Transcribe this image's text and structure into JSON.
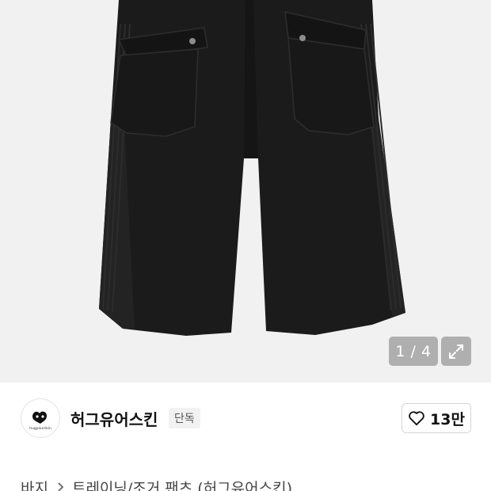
{
  "gallery": {
    "current_page": 1,
    "total_pages": 4,
    "pager_text": "1 / 4",
    "icons": {
      "expand": "expand-arrows-icon"
    }
  },
  "brand": {
    "logo_text": "hugyourskin",
    "name": "허그유어스킨",
    "badge": "단독",
    "like_count": "13만",
    "icons": {
      "like": "heart-outline-icon"
    }
  },
  "breadcrumb": {
    "items": [
      "바지",
      "트레이닝/조거 팬츠 (허그유어스킨)"
    ],
    "separator_icon": "chevron-right-icon"
  },
  "colors": {
    "gallery_bg": "#f1f1f1",
    "pants": "#1c1c1c",
    "text_primary": "#111111",
    "badge_bg": "#f2f2f2"
  }
}
